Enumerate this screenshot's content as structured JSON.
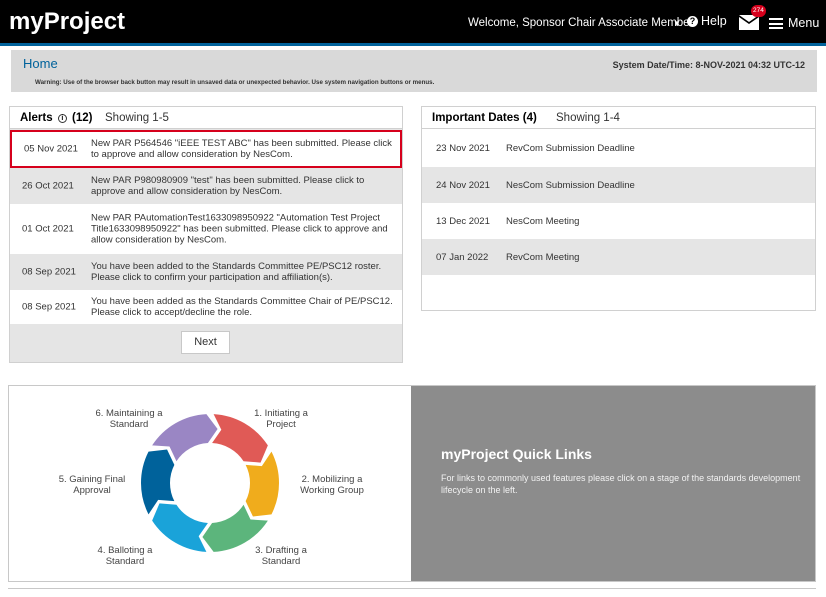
{
  "header": {
    "brand": "myProject",
    "welcome": "Welcome, Sponsor Chair Associate Member",
    "caret": "▼",
    "help_label": "Help",
    "help_icon": "?",
    "mail_badge": "274",
    "menu_label": "Menu"
  },
  "subheader": {
    "home": "Home",
    "warning": "Warning: Use of the browser back button may result in unsaved data or unexpected behavior. Use system navigation buttons or menus.",
    "system_datetime": "System Date/Time: 8-NOV-2021  04:32 UTC-12"
  },
  "alerts": {
    "title": "Alerts",
    "info_icon": "i",
    "count": "(12)",
    "showing": "Showing 1-5",
    "items": [
      {
        "date": "05 Nov 2021",
        "message": "New PAR P564546 \"iEEE TEST ABC\" has been submitted. Please click to approve and allow consideration by NesCom."
      },
      {
        "date": "26 Oct 2021",
        "message": "New PAR P980980909 \"test\" has been submitted. Please click to approve and allow consideration by NesCom."
      },
      {
        "date": "01 Oct 2021",
        "message": "New PAR PAutomationTest1633098950922 \"Automation Test Project Title1633098950922\" has been submitted. Please click to approve and allow consideration by NesCom."
      },
      {
        "date": "08 Sep 2021",
        "message": "You have been added to the Standards Committee PE/PSC12 roster. Please click to confirm your participation and affiliation(s)."
      },
      {
        "date": "08 Sep 2021",
        "message": "You have been added as the Standards Committee Chair of PE/PSC12. Please click to accept/decline the role."
      }
    ],
    "next_label": "Next"
  },
  "important_dates": {
    "title": "Important Dates (4)",
    "showing": "Showing 1-4",
    "items": [
      {
        "date": "23 Nov 2021",
        "event": "RevCom Submission Deadline"
      },
      {
        "date": "24 Nov 2021",
        "event": "NesCom Submission Deadline"
      },
      {
        "date": "13 Dec 2021",
        "event": "NesCom Meeting"
      },
      {
        "date": "07 Jan 2022",
        "event": "RevCom Meeting"
      }
    ]
  },
  "lifecycle": {
    "stages": [
      {
        "label_1": "1. Initiating a",
        "label_2": "Project",
        "color": "#e05a56"
      },
      {
        "label_1": "2. Mobilizing a",
        "label_2": "Working Group",
        "color": "#f0ac1c"
      },
      {
        "label_1": "3. Drafting a",
        "label_2": "Standard",
        "color": "#5cb57c"
      },
      {
        "label_1": "4. Balloting a",
        "label_2": "Standard",
        "color": "#1aa3d9"
      },
      {
        "label_1": "5. Gaining Final",
        "label_2": "Approval",
        "color": "#00629b"
      },
      {
        "label_1": "6. Maintaining a",
        "label_2": "Standard",
        "color": "#9a86c4"
      }
    ]
  },
  "quick_links": {
    "title": "myProject Quick Links",
    "description": "For links to commonly used features please click on a stage of the standards development lifecycle on the left."
  },
  "colors": {
    "top_bar": "#000000",
    "accent": "#00629b",
    "alert_highlight": "#d6001c",
    "quick_links_bg": "#8c8c8c"
  }
}
